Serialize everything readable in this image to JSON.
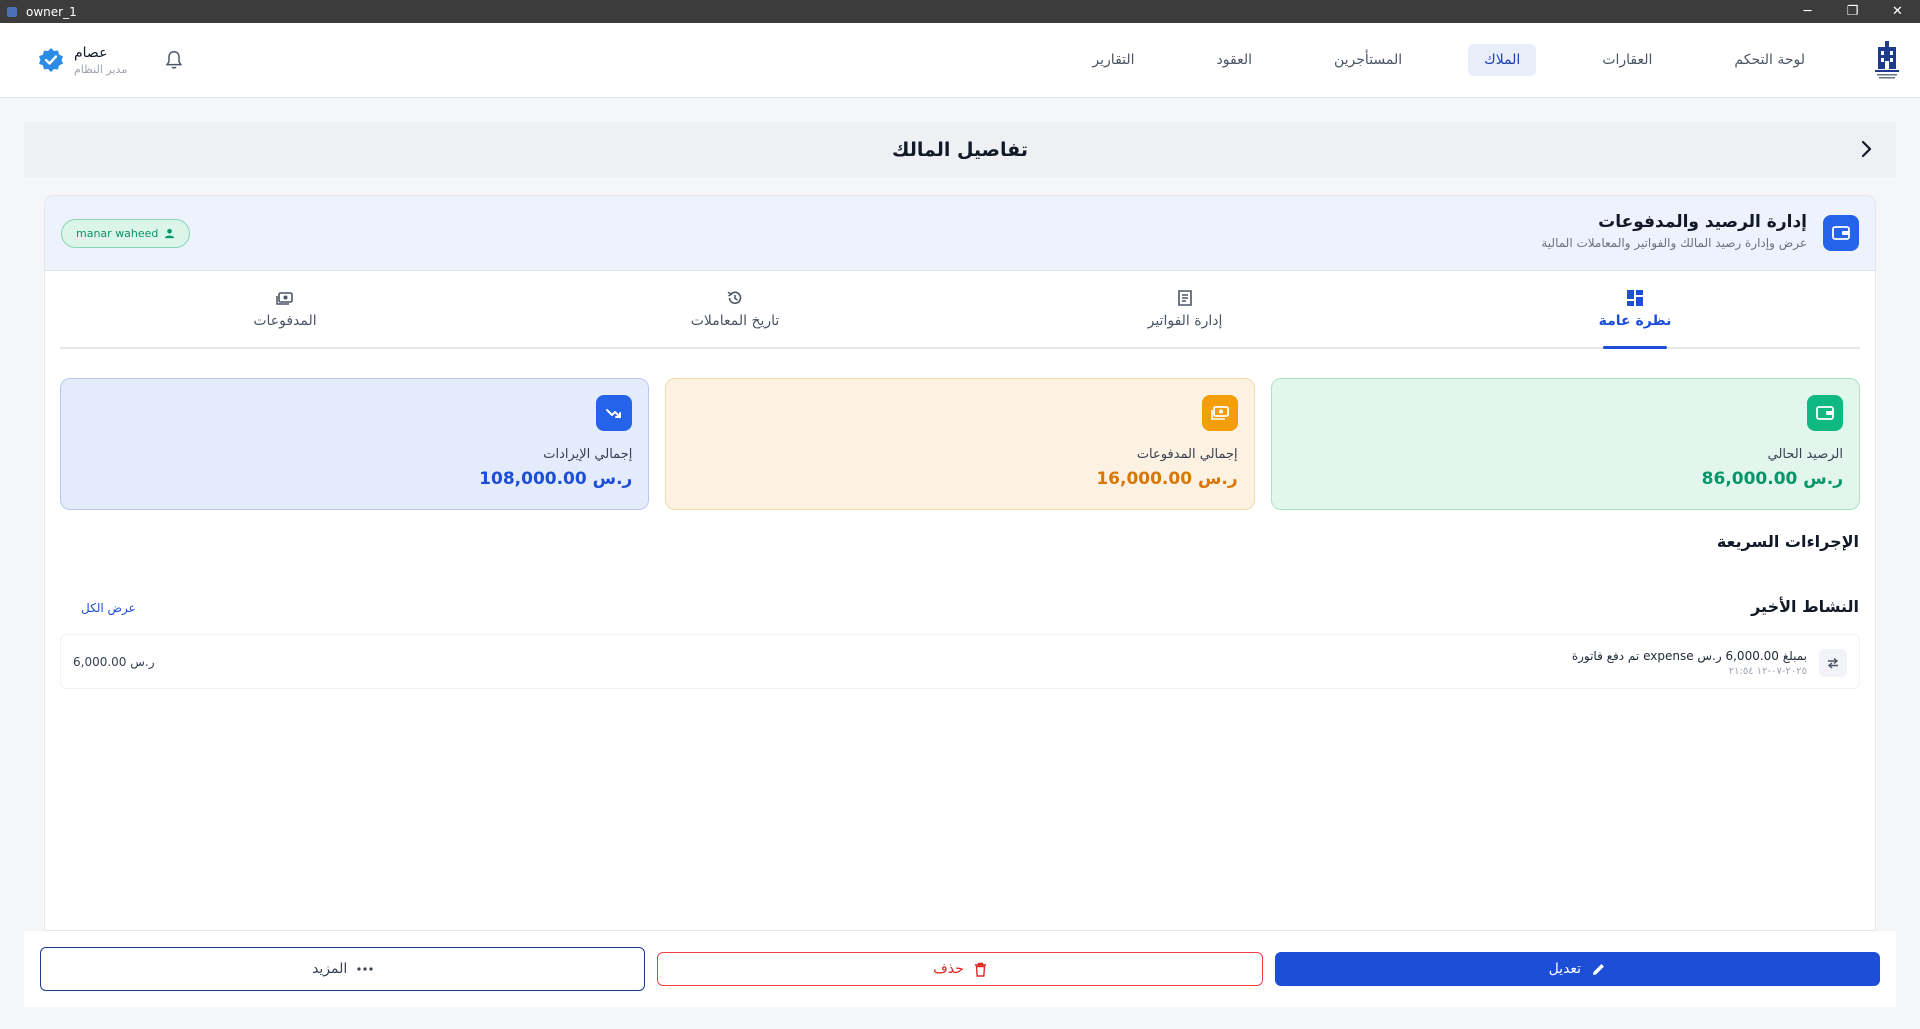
{
  "window": {
    "title": "owner_1",
    "controls": [
      "─",
      "❐",
      "✕"
    ]
  },
  "header": {
    "user": {
      "name": "عصام",
      "role": "مدير النظام"
    },
    "nav": [
      {
        "label": "لوحة التحكم",
        "active": false
      },
      {
        "label": "العقارات",
        "active": false
      },
      {
        "label": "الملاك",
        "active": true
      },
      {
        "label": "المستأجرين",
        "active": false
      },
      {
        "label": "العقود",
        "active": false
      },
      {
        "label": "التقارير",
        "active": false
      }
    ]
  },
  "page": {
    "title": "تفاصيل المالك"
  },
  "card": {
    "title": "إدارة الرصيد والمدفوعات",
    "subtitle": "عرض وإدارة رصيد المالك والفواتير والمعاملات المالية",
    "owner_badge": "manar waheed"
  },
  "tabs": [
    {
      "label": "نظرة عامة",
      "icon": "dashboard-icon",
      "active": true
    },
    {
      "label": "إدارة الفواتير",
      "icon": "receipt-icon",
      "active": false
    },
    {
      "label": "تاريخ المعاملات",
      "icon": "history-icon",
      "active": false
    },
    {
      "label": "المدفوعات",
      "icon": "payments-icon",
      "active": false
    }
  ],
  "stats": [
    {
      "label": "الرصيد الحالي",
      "value": "86,000.00 ر.س",
      "color": "#059669",
      "icon": "wallet-icon"
    },
    {
      "label": "إجمالي المدفوعات",
      "value": "16,000.00 ر.س",
      "color": "#d97706",
      "icon": "cash-icon"
    },
    {
      "label": "إجمالي الإيرادات",
      "value": "108,000.00 ر.س",
      "color": "#1d4ed8",
      "icon": "trend-icon"
    }
  ],
  "quick_actions": {
    "title": "الإجراءات السريعة"
  },
  "recent": {
    "title": "النشاط الأخير",
    "view_all": "عرض الكل",
    "items": [
      {
        "text": "تم دفع فاتورة  expense بمبلغ 6,000.00 ر.س",
        "date": "٢٠٢٥-٠٧-١٢ ٢١:٥٤",
        "amount": "6,000.00 ر.س"
      }
    ]
  },
  "footer": {
    "edit_label": "تعديل",
    "delete_label": "حذف",
    "more_label": "المزيد"
  }
}
